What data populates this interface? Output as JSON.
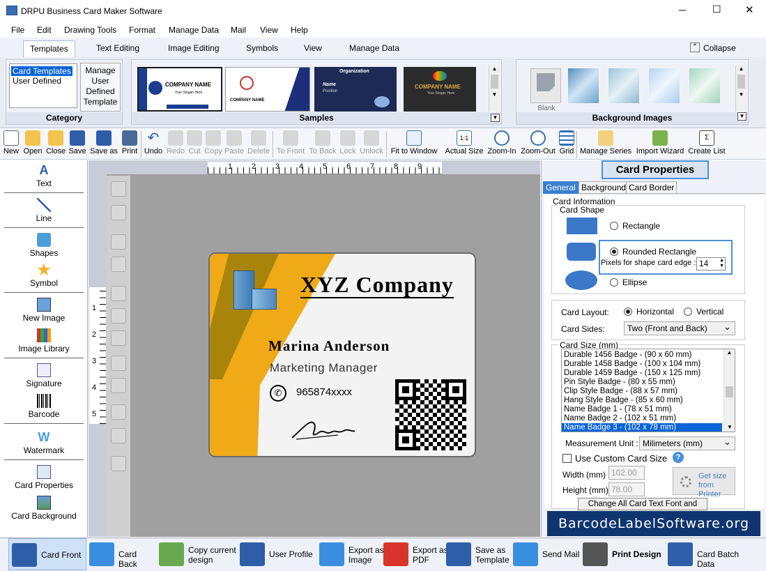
{
  "window": {
    "title": "DRPU Business Card Maker Software",
    "min": "─",
    "max": "☐",
    "close": "✕"
  },
  "menu": [
    "File",
    "Edit",
    "Drawing Tools",
    "Format",
    "Manage Data",
    "Mail",
    "View",
    "Help"
  ],
  "ribbon_tabs": [
    "Templates",
    "Text Editing",
    "Image Editing",
    "Symbols",
    "View",
    "Manage Data"
  ],
  "collapse": "Collapse",
  "category": {
    "caption": "Category",
    "items": [
      "Card Templates",
      "User Defined"
    ],
    "manage": [
      "Manage",
      "User",
      "Defined",
      "Template"
    ]
  },
  "samples": {
    "caption": "Samples",
    "s1": "COMPANY NAME",
    "s1b": "Your Slogan Here",
    "s2": "COMPANY NAME",
    "s3a": "Organization",
    "s3b": "Name",
    "s3c": "Position",
    "s4": "COMPANY NAME",
    "s4b": "Your Slogan Here"
  },
  "bgimages": {
    "caption": "Background Images",
    "blank": "Blank"
  },
  "toolbar": [
    "New",
    "Open",
    "Close",
    "Save",
    "Save as",
    "Print",
    "Undo",
    "Redo",
    "Cut",
    "Copy",
    "Paste",
    "Delete",
    "To Front",
    "To Back",
    "Lock",
    "Unlock",
    "Fit to Window",
    "Actual Size",
    "Zoom-In",
    "Zoom-Out",
    "Grid",
    "Manage Series",
    "Import Wizard",
    "Create List"
  ],
  "lefttools": [
    "Text",
    "Line",
    "Shapes",
    "Symbol",
    "New Image",
    "Image Library",
    "Signature",
    "Barcode",
    "Watermark",
    "Card Properties",
    "Card Background"
  ],
  "ruler": {
    "h": [
      "1",
      "2",
      "3",
      "4",
      "5",
      "6",
      "7",
      "8",
      "9"
    ],
    "v": [
      "1",
      "2",
      "3",
      "4",
      "5"
    ]
  },
  "card": {
    "company": "XYZ Company",
    "name": "Marina Anderson",
    "title": "Marketing Manager",
    "phone": "965874xxxx"
  },
  "props": {
    "title": "Card Properties",
    "tabs": [
      "General",
      "Background",
      "Card Border"
    ],
    "card_info": "Card Information",
    "card_shape": "Card Shape",
    "rect": "Rectangle",
    "rounded": "Rounded Rectangle",
    "pixels_label": "Pixels for shape card edge :",
    "pixels": "14",
    "ellipse": "Ellipse",
    "layout_label": "Card Layout:",
    "horizontal": "Horizontal",
    "vertical": "Vertical",
    "sides_label": "Card Sides:",
    "sides": "Two (Front and Back)",
    "size_label": "Card Size (mm)",
    "sizes": [
      "Durable 1456  Badge  -   (90 x 60 mm)",
      "Durable 1458  Badge  -   (100 x 104 mm)",
      "Durable 1459  Badge  -   (150 x 125 mm)",
      "Pin Style Badge  -   (80 x 55 mm)",
      "Clip Style Badge  -   (88 x 57 mm)",
      "Hang Style Badge  -   (85 x 60 mm)",
      "Name Badge 1  -   (78 x 51 mm)",
      "Name Badge 2  -   (102 x 51 mm)",
      "Name Badge 3  -   (102 x 78 mm)"
    ],
    "unit_label": "Measurement Unit :",
    "unit": "Milimeters (mm)",
    "custom": "Use Custom Card Size",
    "width_label": "Width   (mm)",
    "width": "102.00",
    "height_label": "Height  (mm)",
    "height": "78.00",
    "getsize": "Get size from Printer",
    "change_font": "Change All Card Text Font and Color",
    "watermark": "BarcodeLabelSoftware.org"
  },
  "bottom": [
    "Card Front",
    "Card Back",
    "Copy current design",
    "User Profile",
    "Export as Image",
    "Export as PDF",
    "Save as Template",
    "Send Mail",
    "Print Design",
    "Card Batch Data"
  ]
}
